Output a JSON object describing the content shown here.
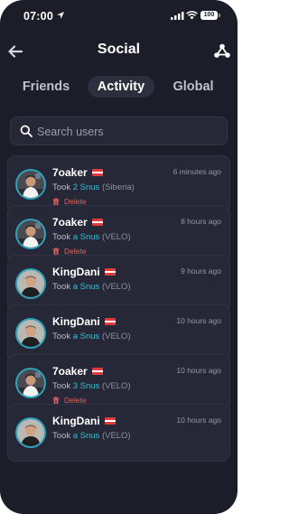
{
  "status_bar": {
    "time": "07:00",
    "battery": "100"
  },
  "header": {
    "title": "Social"
  },
  "tabs": [
    {
      "label": "Friends",
      "active": false
    },
    {
      "label": "Activity",
      "active": true
    },
    {
      "label": "Global",
      "active": false
    }
  ],
  "search": {
    "placeholder": "Search users",
    "value": ""
  },
  "colors": {
    "background": "#1b1d29",
    "card": "#262837",
    "accent": "#2fc1d8",
    "delete": "#e06161"
  },
  "feed": [
    {
      "user": "7oaker",
      "time": "6 minutes ago",
      "took": "Took",
      "amount": "2 Snus",
      "brand": "(Siberia)",
      "delete": "Delete",
      "avatar": "7oaker"
    },
    {
      "user": "7oaker",
      "time": "8 hours ago",
      "took": "Took",
      "amount": "a Snus",
      "brand": "(VELO)",
      "delete": "Delete",
      "avatar": "7oaker"
    },
    {
      "user": "KingDani",
      "time": "9 hours ago",
      "took": "Took",
      "amount": "a Snus",
      "brand": "(VELO)",
      "delete": "",
      "avatar": "KingDani"
    },
    {
      "user": "KingDani",
      "time": "10 hours ago",
      "took": "Took",
      "amount": "a Snus",
      "brand": "(VELO)",
      "delete": "",
      "avatar": "KingDani"
    },
    {
      "user": "7oaker",
      "time": "10 hours ago",
      "took": "Took",
      "amount": "3 Snus",
      "brand": "(VELO)",
      "delete": "Delete",
      "avatar": "7oaker"
    },
    {
      "user": "KingDani",
      "time": "10 hours ago",
      "took": "Took",
      "amount": "a Snus",
      "brand": "(VELO)",
      "delete": "",
      "avatar": "KingDani"
    }
  ],
  "icons": {
    "back": "arrow-left-icon",
    "share": "share-icon",
    "search": "search-icon",
    "delete": "trash-icon",
    "flag": "austria-flag-icon"
  }
}
